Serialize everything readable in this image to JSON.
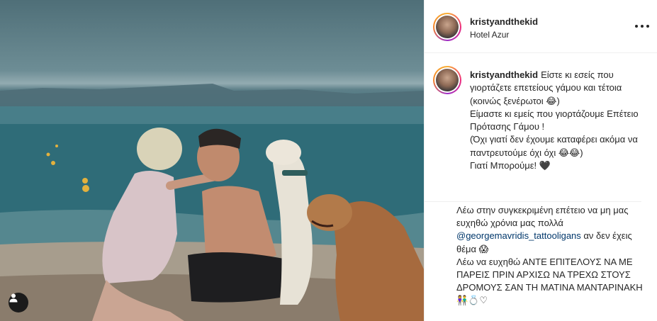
{
  "post": {
    "username": "kristyandthekid",
    "location": "Hotel Azur",
    "photo_alt": "Couple embracing on a beach with two dogs",
    "icons": {
      "more": "more-options-icon",
      "user_tags": "user-tags-icon"
    }
  },
  "caption": {
    "username": "kristyandthekid",
    "text": "Είστε κι εσείς που γιορτάζετε επετείους γάμου και τέτοια (κοινώς ξενέρωτοι 😂)\nΕίμαστε κι εμείς που γιορτάζουμε Επέτειο Πρότασης Γάμου !\n(Όχι γιατί δεν έχουμε καταφέρει ακόμα να παντρευτούμε όχι όχι 😂😂)\nΓιατί Μπορούμε! 🖤"
  },
  "comment": {
    "line1": "Λέω στην συγκεκριμένη επέτειο να μη μας ευχηθώ χρόνια μας πολλά ",
    "mention": "@georgemavridis_tattooligans",
    "line2": " αν δεν έχεις θέμα 😱\nΛέω να ευχηθώ ΑΝΤΕ ΕΠΙΤΕΛΟΥΣ ΝΑ ΜΕ ΠΑΡΕΙΣ ΠΡΙΝ ΑΡΧΙΣΩ ΝΑ ΤΡΕΧΩ ΣΤΟΥΣ ΔΡΟΜΟΥΣ ΣΑΝ ΤΗ ΜΑΤΙΝΑ ΜΑΝΤΑΡΙΝΑΚΗ 👫💍♡"
  },
  "colors": {
    "link": "#00376b",
    "text": "#262626",
    "border": "#efefef"
  }
}
